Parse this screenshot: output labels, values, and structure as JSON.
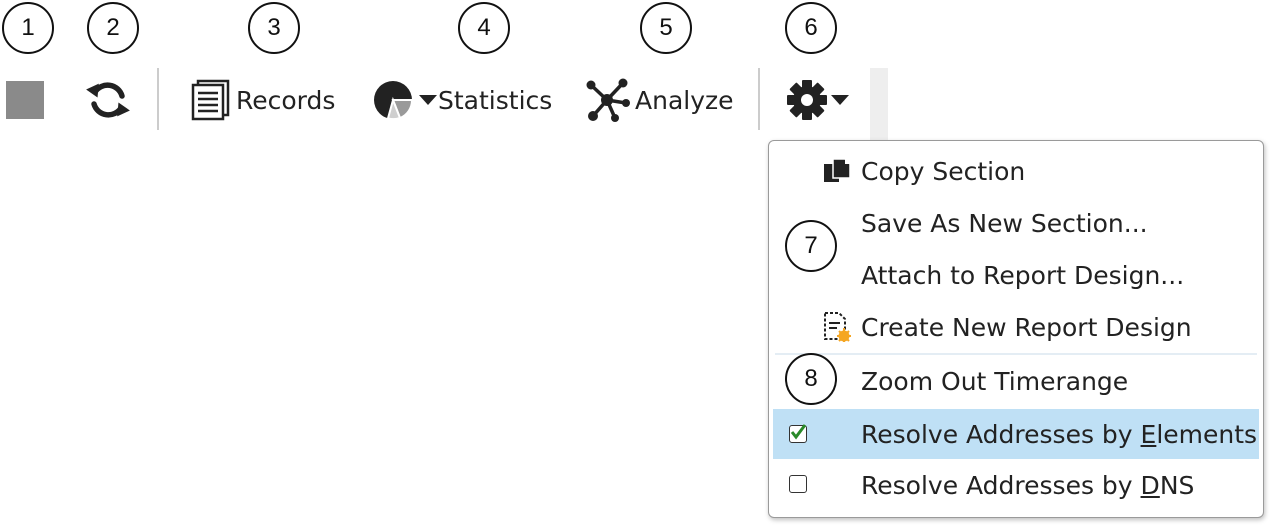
{
  "callouts": [
    "1",
    "2",
    "3",
    "4",
    "5",
    "6",
    "7",
    "8"
  ],
  "toolbar": {
    "stop_icon": "stop-square-icon",
    "refresh_icon": "refresh-icon",
    "records_label": "Records",
    "statistics_label": "Statistics",
    "analyze_label": "Analyze",
    "settings_icon": "gear-icon"
  },
  "menu": {
    "items": [
      {
        "label": "Copy Section",
        "icon": "copy-icon"
      },
      {
        "label": "Save As New Section..."
      },
      {
        "label": "Attach to Report Design..."
      },
      {
        "label": "Create New Report Design",
        "icon": "report-design-icon"
      },
      {
        "label": "Zoom Out Timerange"
      },
      {
        "pre": "Resolve Addresses by ",
        "accel": "E",
        "post": "lements",
        "checked": true,
        "highlighted": true
      },
      {
        "pre": "Resolve Addresses by ",
        "accel": "D",
        "post": "NS",
        "checked": false
      }
    ]
  },
  "colors": {
    "highlight": "#bfe0f5",
    "check": "#2a8a2a",
    "icon_dark": "#222222",
    "stop_gray": "#8a8a8a"
  }
}
